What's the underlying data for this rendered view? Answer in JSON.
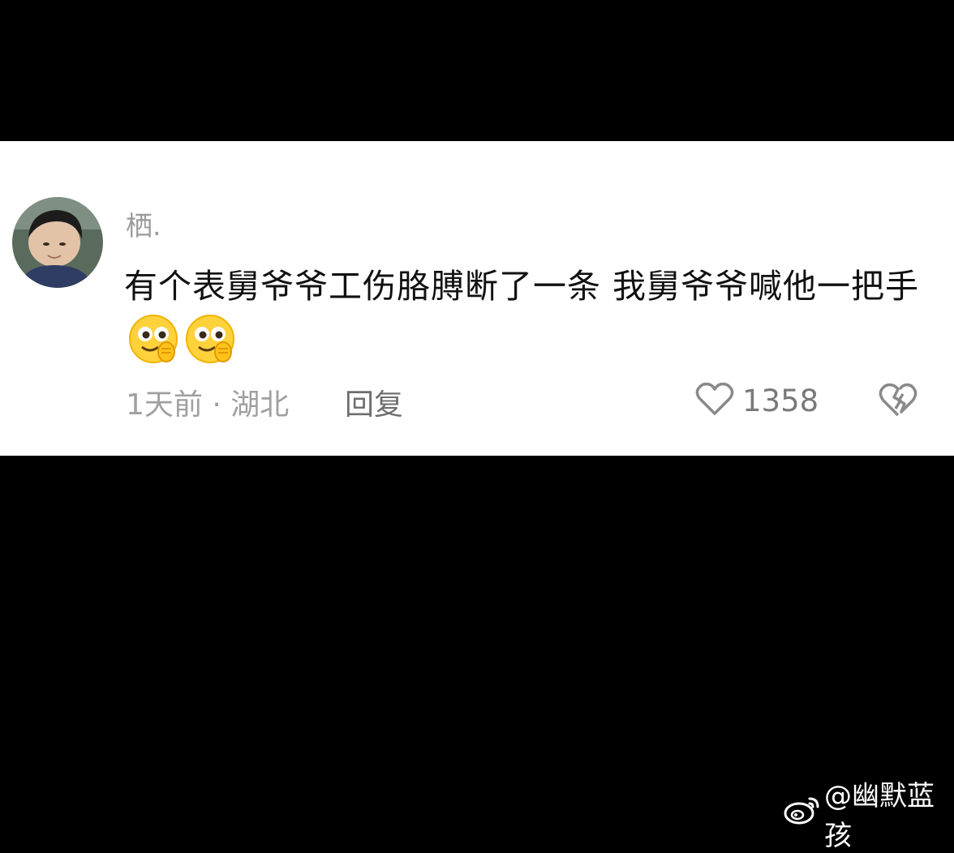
{
  "comment": {
    "username": "栖.",
    "text": "有个表舅爷爷工伤胳膊断了一条 我舅爷爷喊他一把手",
    "emojis": [
      "face-with-hand-over-mouth-emoji",
      "face-with-hand-over-mouth-emoji"
    ],
    "time_location": "1天前 · 湖北",
    "reply_label": "回复",
    "like_count": "1358",
    "icons": {
      "like": "heart-outline-icon",
      "dislike": "broken-heart-icon"
    }
  },
  "watermark": {
    "icon": "weibo-logo-icon",
    "text": "@幽默蓝孩"
  },
  "colors": {
    "background": "#000000",
    "card": "#ffffff",
    "text_primary": "#111111",
    "text_secondary": "#9a9a9a"
  }
}
